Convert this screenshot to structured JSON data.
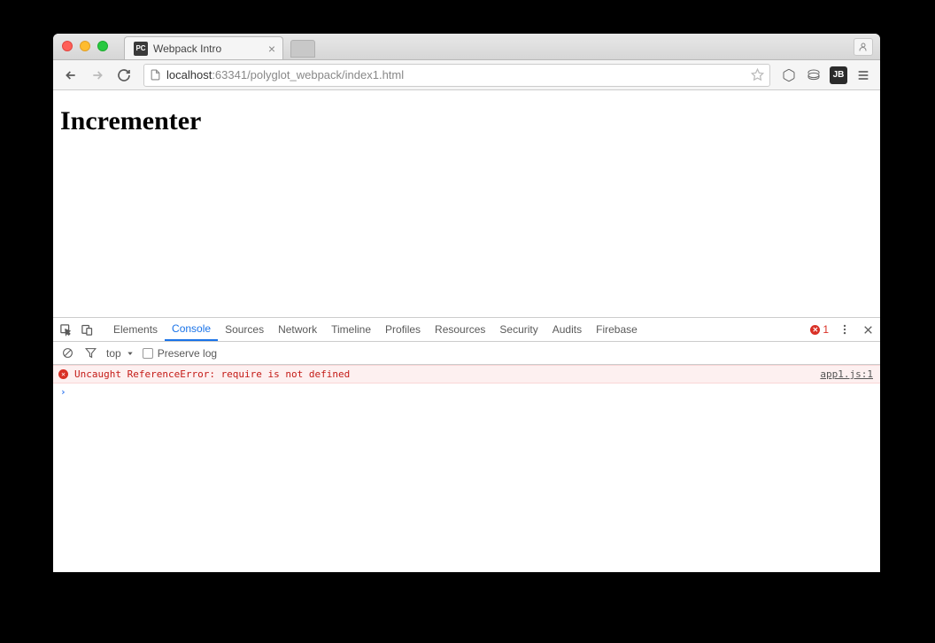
{
  "tab": {
    "title": "Webpack Intro",
    "favicon_text": "PC"
  },
  "address": {
    "host": "localhost",
    "port_path": ":63341/polyglot_webpack/index1.html"
  },
  "page": {
    "heading": "Incrementer"
  },
  "devtools": {
    "tabs": [
      "Elements",
      "Console",
      "Sources",
      "Network",
      "Timeline",
      "Profiles",
      "Resources",
      "Security",
      "Audits",
      "Firebase"
    ],
    "active_tab": "Console",
    "error_count": "1",
    "filter": {
      "context": "top",
      "preserve_label": "Preserve log"
    },
    "console": {
      "error_message": "Uncaught ReferenceError: require is not defined",
      "error_source": "app1.js:1"
    }
  },
  "ext": {
    "jb_label": "JB"
  }
}
